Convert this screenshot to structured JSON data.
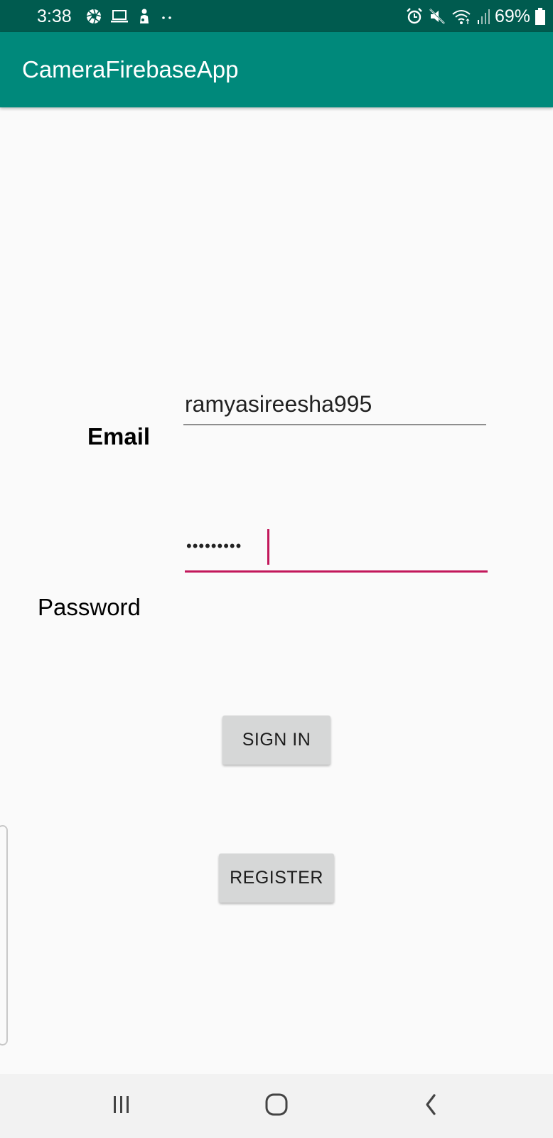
{
  "status_bar": {
    "time": "3:38",
    "battery": "69%",
    "left_icons": [
      "camera-aperture-icon",
      "laptop-icon",
      "person-icon",
      "dots-icon"
    ],
    "right_icons": [
      "alarm-icon",
      "mute-icon",
      "wifi-icon",
      "signal-icon",
      "battery-icon"
    ]
  },
  "app_bar": {
    "title": "CameraFirebaseApp"
  },
  "form": {
    "email_label": "Email",
    "email_value": "ramyasireesha995",
    "password_label": "Password",
    "password_value": "•••••••••"
  },
  "buttons": {
    "sign_in": "SIGN IN",
    "register": "REGISTER"
  },
  "nav_bar": {
    "icons": [
      "recents-icon",
      "home-icon",
      "back-icon"
    ]
  },
  "colors": {
    "status_bar": "#005b4f",
    "app_bar": "#00897b",
    "accent": "#c2185b",
    "background": "#fafafa",
    "button": "#d6d7d7"
  }
}
